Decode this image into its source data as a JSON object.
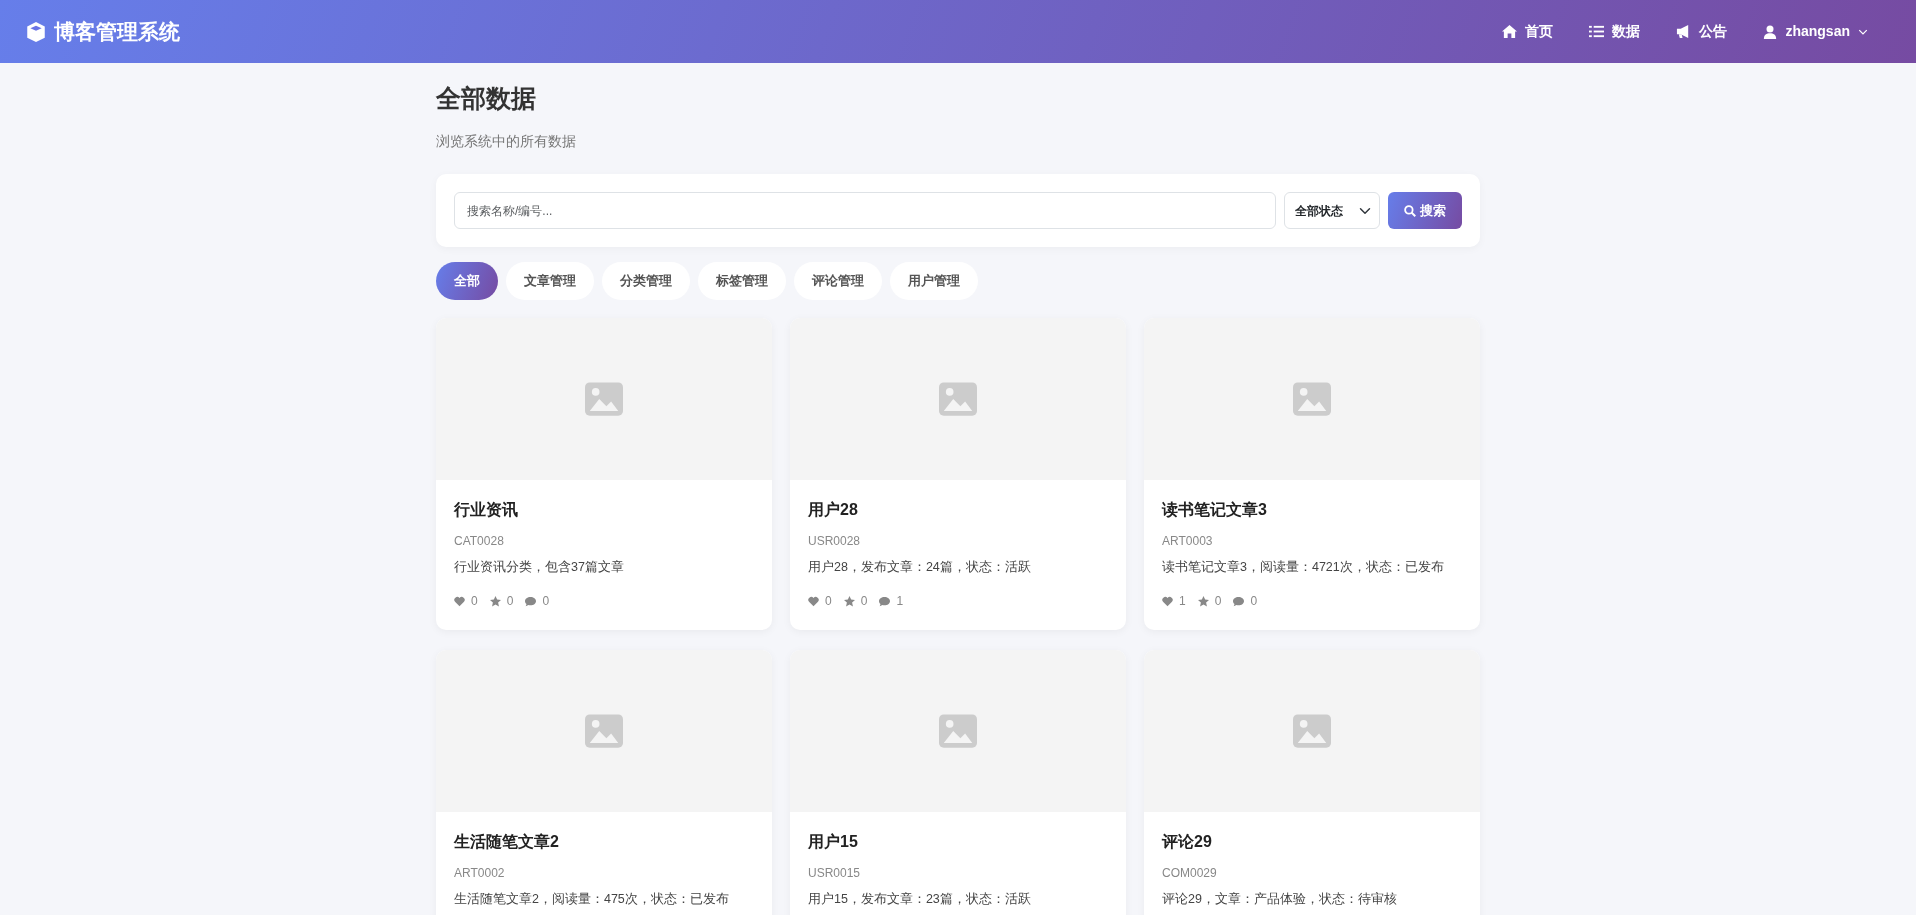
{
  "navbar": {
    "brand": "博客管理系统",
    "links": [
      {
        "kind": "home",
        "label": "首页"
      },
      {
        "kind": "list",
        "label": "数据"
      },
      {
        "kind": "megaphone",
        "label": "公告"
      }
    ],
    "user": {
      "label": "zhangsan"
    }
  },
  "page": {
    "title": "全部数据",
    "subtitle": "浏览系统中的所有数据"
  },
  "search": {
    "placeholder": "搜索名称/编号...",
    "status_select": "全部状态",
    "button": "搜索"
  },
  "tabs": [
    {
      "label": "全部",
      "selected": true
    },
    {
      "label": "文章管理",
      "selected": false
    },
    {
      "label": "分类管理",
      "selected": false
    },
    {
      "label": "标签管理",
      "selected": false
    },
    {
      "label": "评论管理",
      "selected": false
    },
    {
      "label": "用户管理",
      "selected": false
    }
  ],
  "cards": [
    {
      "title": "行业资讯",
      "code": "CAT0028",
      "description": "行业资讯分类，包含37篇文章",
      "likes": "0",
      "favorites": "0",
      "comments": "0"
    },
    {
      "title": "用户28",
      "code": "USR0028",
      "description": "用户28，发布文章：24篇，状态：活跃",
      "likes": "0",
      "favorites": "0",
      "comments": "1"
    },
    {
      "title": "读书笔记文章3",
      "code": "ART0003",
      "description": "读书笔记文章3，阅读量：4721次，状态：已发布",
      "likes": "1",
      "favorites": "0",
      "comments": "0"
    },
    {
      "title": "生活随笔文章2",
      "code": "ART0002",
      "description": "生活随笔文章2，阅读量：475次，状态：已发布"
    },
    {
      "title": "用户15",
      "code": "USR0015",
      "description": "用户15，发布文章：23篇，状态：活跃"
    },
    {
      "title": "评论29",
      "code": "COM0029",
      "description": "评论29，文章：产品体验，状态：待审核"
    }
  ]
}
